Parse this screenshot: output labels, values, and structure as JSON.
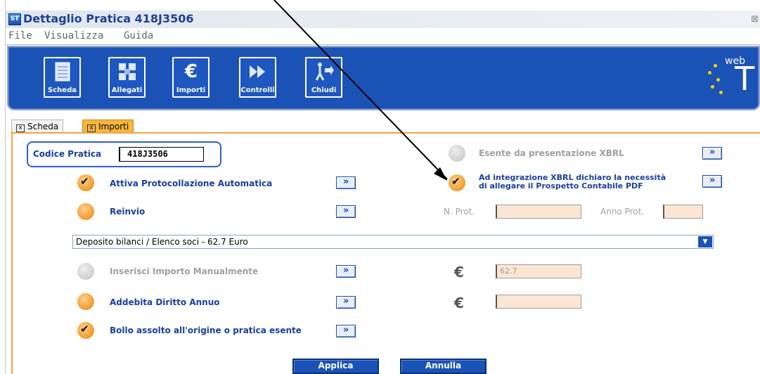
{
  "window": {
    "title": "Dettaglio Pratica 418J3506",
    "app_icon": "app-icon",
    "close_glyph": "x"
  },
  "menu": {
    "items": [
      {
        "label": "File",
        "key": "F"
      },
      {
        "label": "Visualizza",
        "key": "V"
      },
      {
        "label": "Guida",
        "key": "G"
      }
    ]
  },
  "toolbar": {
    "buttons": [
      {
        "label": "Scheda",
        "icon": "document-icon"
      },
      {
        "label": "Allegati",
        "icon": "attachments-icon"
      },
      {
        "label": "Importi",
        "icon": "euro-icon"
      },
      {
        "label": "Controlli",
        "icon": "fast-forward-icon"
      },
      {
        "label": "Chiudi",
        "icon": "exit-icon"
      }
    ],
    "logo_small": "web",
    "logo_big": "T"
  },
  "tabs": [
    {
      "label": "Scheda",
      "active": false
    },
    {
      "label": "Importi",
      "active": true
    }
  ],
  "form": {
    "codice_label": "Codice Pratica",
    "codice_value": "418J3506",
    "esente_label": "Esente da presentazione XBRL",
    "attiva_label": "Attiva Protocollazione Automatica",
    "integrazione_line1": "Ad integrazione XBRL dichiaro la necessità",
    "integrazione_line2": "di allegare il Prospetto Contabile PDF",
    "reinvio_label": "Reinvio",
    "nprot_label": "N. Prot.",
    "annoprot_label": "Anno Prot.",
    "select_value": "Deposito bilanci / Elenco soci - 62.7 Euro",
    "inserisci_label": "Inserisci Importo Manualmente",
    "importo_value": "62.7",
    "addebita_label": "Addebita Diritto Annuo",
    "bollo_label": "Bollo assolto all'origine o pratica esente",
    "euro_symbol": "€",
    "checkmark": "✔"
  },
  "actions": {
    "apply": "Applica",
    "cancel": "Annulla"
  },
  "colors": {
    "accent_blue": "#1b52b5",
    "label_blue": "#1a3f9c",
    "orange": "#f29a2e",
    "disabled_field": "#fbe6d4"
  }
}
